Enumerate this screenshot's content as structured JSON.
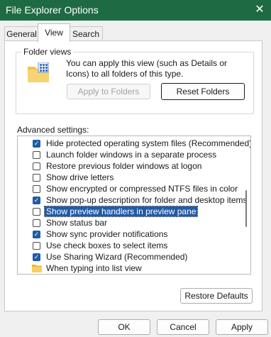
{
  "window": {
    "title": "File Explorer Options",
    "close_glyph": "✕"
  },
  "tabs": [
    {
      "label": "General",
      "active": false
    },
    {
      "label": "View",
      "active": true
    },
    {
      "label": "Search",
      "active": false
    }
  ],
  "folder_views": {
    "legend": "Folder views",
    "description": "You can apply this view (such as Details or Icons) to all folders of this type.",
    "apply_button": "Apply to Folders",
    "reset_button": "Reset Folders",
    "icon": "folder-grid-icon"
  },
  "advanced": {
    "label": "Advanced settings:",
    "items": [
      {
        "text": "Hide protected operating system files (Recommended)",
        "checked": true,
        "type": "checkbox"
      },
      {
        "text": "Launch folder windows in a separate process",
        "checked": false,
        "type": "checkbox"
      },
      {
        "text": "Restore previous folder windows at logon",
        "checked": false,
        "type": "checkbox"
      },
      {
        "text": "Show drive letters",
        "checked": false,
        "type": "checkbox"
      },
      {
        "text": "Show encrypted or compressed NTFS files in color",
        "checked": false,
        "type": "checkbox"
      },
      {
        "text": "Show pop-up description for folder and desktop items",
        "checked": true,
        "type": "checkbox"
      },
      {
        "text": "Show preview handlers in preview pane",
        "checked": false,
        "type": "checkbox",
        "selected": true
      },
      {
        "text": "Show status bar",
        "checked": false,
        "type": "checkbox"
      },
      {
        "text": "Show sync provider notifications",
        "checked": true,
        "type": "checkbox"
      },
      {
        "text": "Use check boxes to select items",
        "checked": false,
        "type": "checkbox"
      },
      {
        "text": "Use Sharing Wizard (Recommended)",
        "checked": true,
        "type": "checkbox"
      },
      {
        "text": "When typing into list view",
        "type": "folder"
      }
    ],
    "restore_button": "Restore Defaults"
  },
  "footer": {
    "ok": "OK",
    "cancel": "Cancel",
    "apply": "Apply"
  },
  "colors": {
    "title_bar": "#1e6b43",
    "accent": "#1f5ca8"
  }
}
